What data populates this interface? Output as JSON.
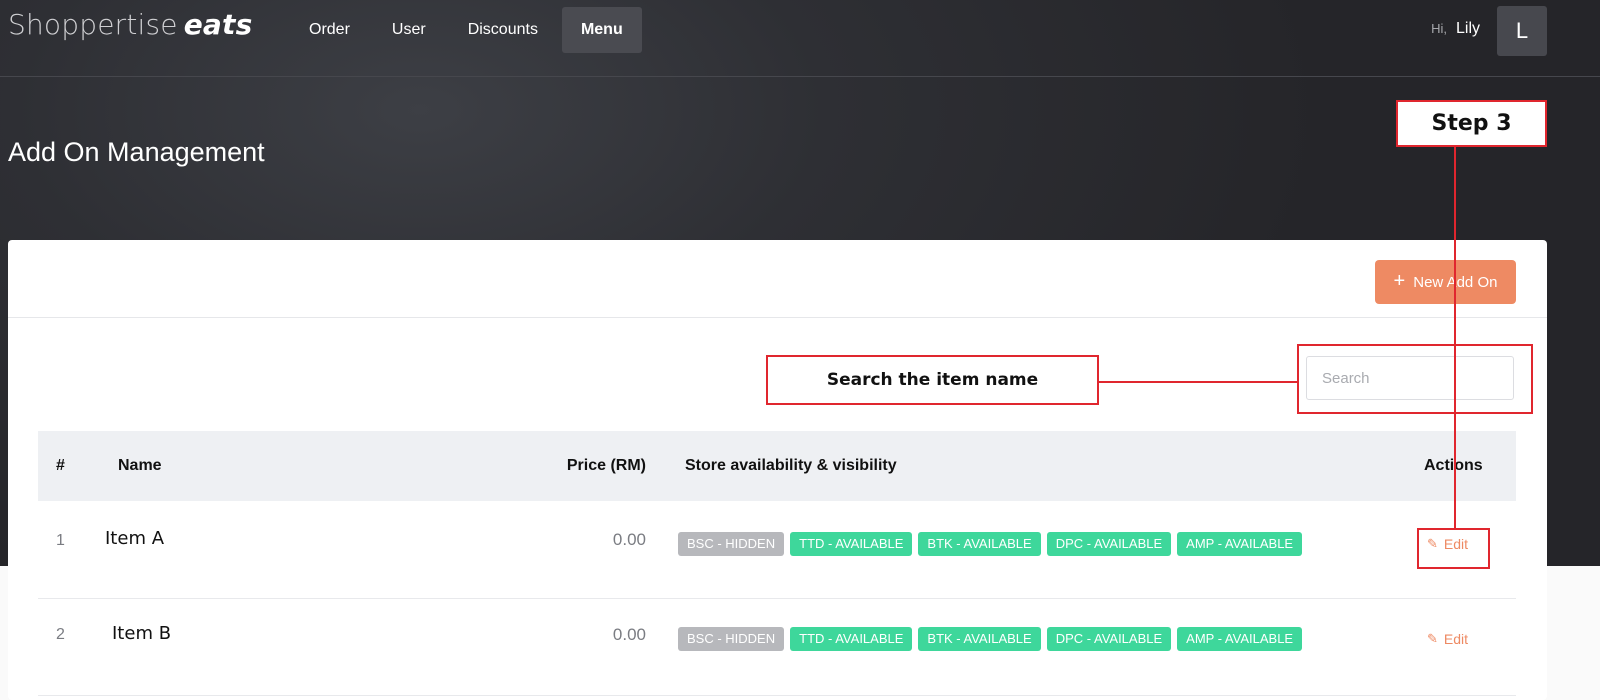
{
  "brand": {
    "part1": "Shoppertise",
    "part2": "eats"
  },
  "nav": {
    "items": [
      "Order",
      "User",
      "Discounts",
      "Menu"
    ],
    "active": "Menu"
  },
  "user": {
    "greeting": "Hi,",
    "name": "Lily",
    "initial": "L"
  },
  "page": {
    "title": "Add On Management"
  },
  "toolbar": {
    "new_label": "New Add On",
    "new_icon": "plus-icon"
  },
  "search": {
    "placeholder": "Search",
    "value": ""
  },
  "table": {
    "headers": {
      "num": "#",
      "name": "Name",
      "price": "Price (RM)",
      "stores": "Store availability & visibility",
      "actions": "Actions"
    },
    "rows": [
      {
        "num": "1",
        "name": "Item A",
        "price": "0.00",
        "badges": [
          "BSC - HIDDEN",
          "TTD - AVAILABLE",
          "BTK - AVAILABLE",
          "DPC - AVAILABLE",
          "AMP - AVAILABLE"
        ],
        "action": "Edit"
      },
      {
        "num": "2",
        "name": "Item B",
        "price": "0.00",
        "badges": [
          "BSC - HIDDEN",
          "TTD - AVAILABLE",
          "BTK - AVAILABLE",
          "DPC - AVAILABLE",
          "AMP - AVAILABLE"
        ],
        "action": "Edit"
      }
    ]
  },
  "annotations": {
    "search_hint": "Search the item name",
    "step": "Step 3"
  },
  "colors": {
    "accent": "#ee8a63",
    "available": "#3ed79b",
    "hidden": "#b7b8bc",
    "annotation": "#e0262e"
  }
}
